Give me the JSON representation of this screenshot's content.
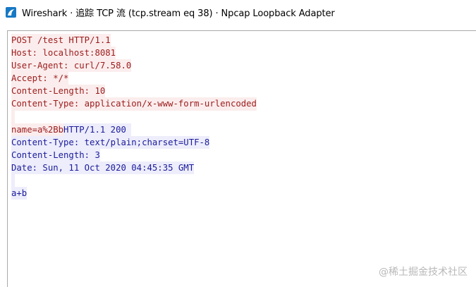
{
  "window": {
    "title": "Wireshark · 追踪 TCP 流 (tcp.stream eq 38) · Npcap Loopback Adapter",
    "app_icon": "wireshark-fin-icon",
    "accent_color": "#1679c5"
  },
  "stream": {
    "client_bg": "#fbeded",
    "client_fg": "#9c1b1b",
    "server_bg": "#ededfb",
    "server_fg": "#1b1b9c",
    "request_lines": [
      "POST /test HTTP/1.1",
      "Host: localhost:8081",
      "User-Agent: curl/7.58.0",
      "Accept: */*",
      "Content-Length: 10",
      "Content-Type: application/x-www-form-urlencoded"
    ],
    "request_body": "name=a%2Bb",
    "response_status": "HTTP/1.1 200 ",
    "response_headers": [
      "Content-Type: text/plain;charset=UTF-8",
      "Content-Length: 3",
      "Date: Sun, 11 Oct 2020 04:45:35 GMT"
    ],
    "response_body": "a+b"
  },
  "watermark": "@稀土掘金技术社区"
}
